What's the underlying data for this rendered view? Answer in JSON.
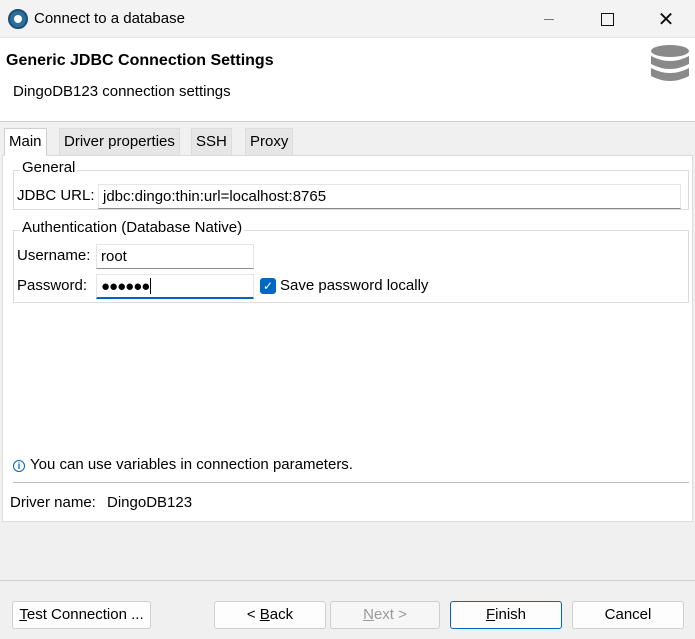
{
  "window": {
    "title": "Connect to a database"
  },
  "header": {
    "title": "Generic JDBC Connection Settings",
    "subtitle": "DingoDB123 connection settings",
    "icon": "database-icon"
  },
  "tabs": [
    {
      "label": "Main",
      "active": true
    },
    {
      "label": "Driver properties",
      "active": false
    },
    {
      "label": "SSH",
      "active": false
    },
    {
      "label": "Proxy",
      "active": false
    }
  ],
  "general": {
    "group_label": "General",
    "jdbc_label": "JDBC URL:",
    "jdbc_value": "jdbc:dingo:thin:url=localhost:8765"
  },
  "auth": {
    "group_label": "Authentication (Database Native)",
    "username_label": "Username:",
    "username_value": "root",
    "password_label": "Password:",
    "password_value": "●●●●●●",
    "save_password_label": "Save password locally",
    "save_password_checked": true
  },
  "info": {
    "text": "You can use variables in connection parameters."
  },
  "driver": {
    "label": "Driver name:",
    "value": "DingoDB123"
  },
  "buttons": {
    "test_first": "T",
    "test_rest": "est Connection ...",
    "back_prefix": "< ",
    "back_mnemonic": "B",
    "back_rest": "ack",
    "next_mnemonic": "N",
    "next_rest": "ext >",
    "finish_mnemonic": "F",
    "finish_rest": "inish",
    "cancel": "Cancel"
  },
  "colors": {
    "accent": "#0067c0",
    "db_icon": "#8a8a8a"
  }
}
